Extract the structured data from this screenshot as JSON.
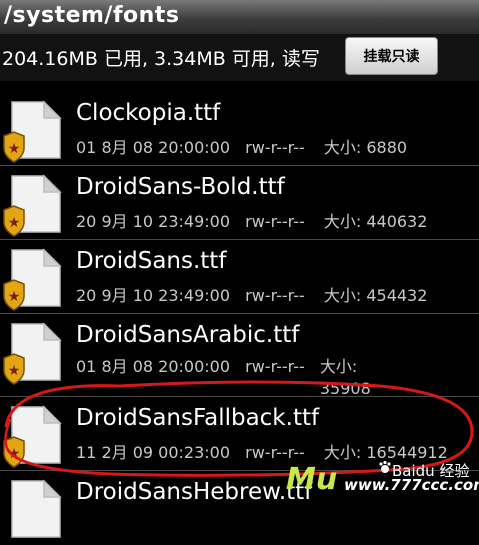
{
  "app": {
    "path_title": "/system/fonts"
  },
  "status": {
    "storage_text": "204.16MB 已用, 3.34MB 可用, 读写",
    "mount_button_label": "挂载只读"
  },
  "files": [
    {
      "name": "Clockopia.ttf",
      "date": "01 8月 08 20:00:00",
      "perms": "rw-r--r--",
      "size_label": "大小: 6880"
    },
    {
      "name": "DroidSans-Bold.ttf",
      "date": "20 9月 10 23:49:00",
      "perms": "rw-r--r--",
      "size_label": "大小: 440632"
    },
    {
      "name": "DroidSans.ttf",
      "date": "20 9月 10 23:49:00",
      "perms": "rw-r--r--",
      "size_label": "大小: 454432"
    },
    {
      "name": "DroidSansArabic.ttf",
      "date": "01 8月 08 20:00:00",
      "perms": "rw-r--r--",
      "size_label": "大小: 35908"
    },
    {
      "name": "DroidSansFallback.ttf",
      "date": "11 2月 09 00:23:00",
      "perms": "rw-r--r--",
      "size_label": "大小: 16544912"
    },
    {
      "name": "DroidSansHebrew.ttf",
      "date": "",
      "perms": "",
      "size_label": ""
    }
  ],
  "watermark": {
    "brand_text": "Mu",
    "url_text": "www.777ccc.com",
    "baidu_text": "Baidu 经验"
  },
  "colors": {
    "annotation_stroke": "#d81818",
    "badge_gold": "#e2a514"
  },
  "icons": {
    "file_icon": "ttf-file-icon",
    "badge_icon": "shield-star-icon"
  }
}
